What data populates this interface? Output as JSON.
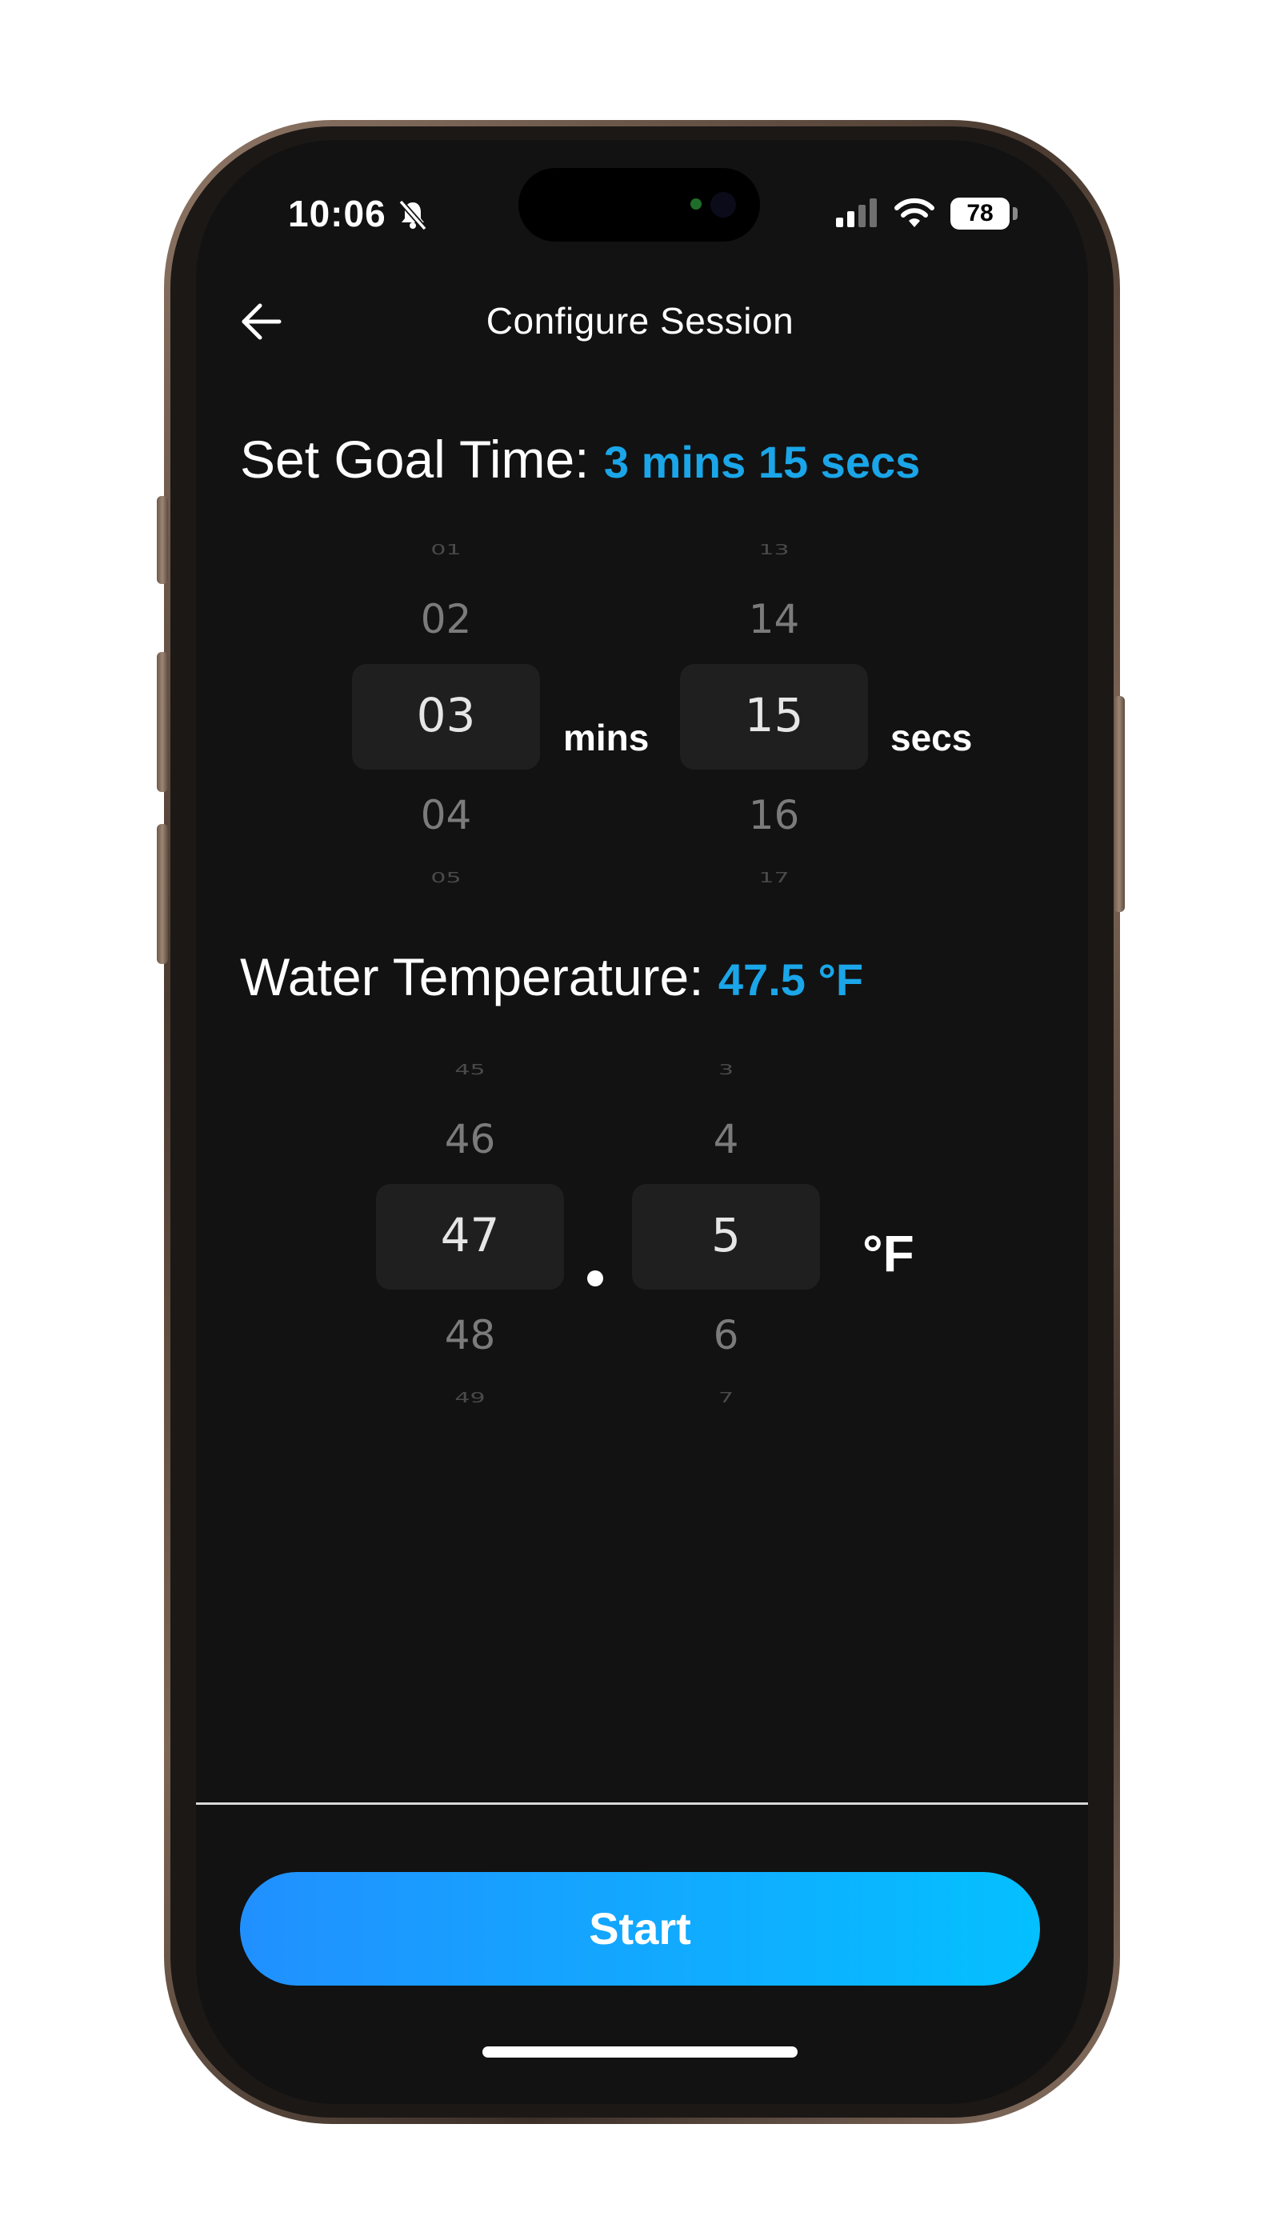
{
  "status_bar": {
    "time": "10:06",
    "battery": "78"
  },
  "header": {
    "title": "Configure Session"
  },
  "goal_time": {
    "label": "Set Goal Time: ",
    "value": "3 mins 15 secs",
    "minutes": {
      "far_above": "01",
      "above": "02",
      "selected": "03",
      "below": "04",
      "far_below": "05",
      "unit": "mins"
    },
    "seconds": {
      "far_above": "13",
      "above": "14",
      "selected": "15",
      "below": "16",
      "far_below": "17",
      "unit": "secs"
    }
  },
  "water_temp": {
    "label": "Water Temperature: ",
    "value": "47.5 °F",
    "whole": {
      "far_above": "45",
      "above": "46",
      "selected": "47",
      "below": "48",
      "far_below": "49"
    },
    "decimal": {
      "far_above": "3",
      "above": "4",
      "selected": "5",
      "below": "6",
      "far_below": "7"
    },
    "unit": "°F"
  },
  "footer": {
    "start_label": "Start"
  },
  "colors": {
    "accent": "#1aa6e8",
    "button_start": "#2190ff",
    "button_end": "#04c0ff",
    "background": "#121212"
  }
}
